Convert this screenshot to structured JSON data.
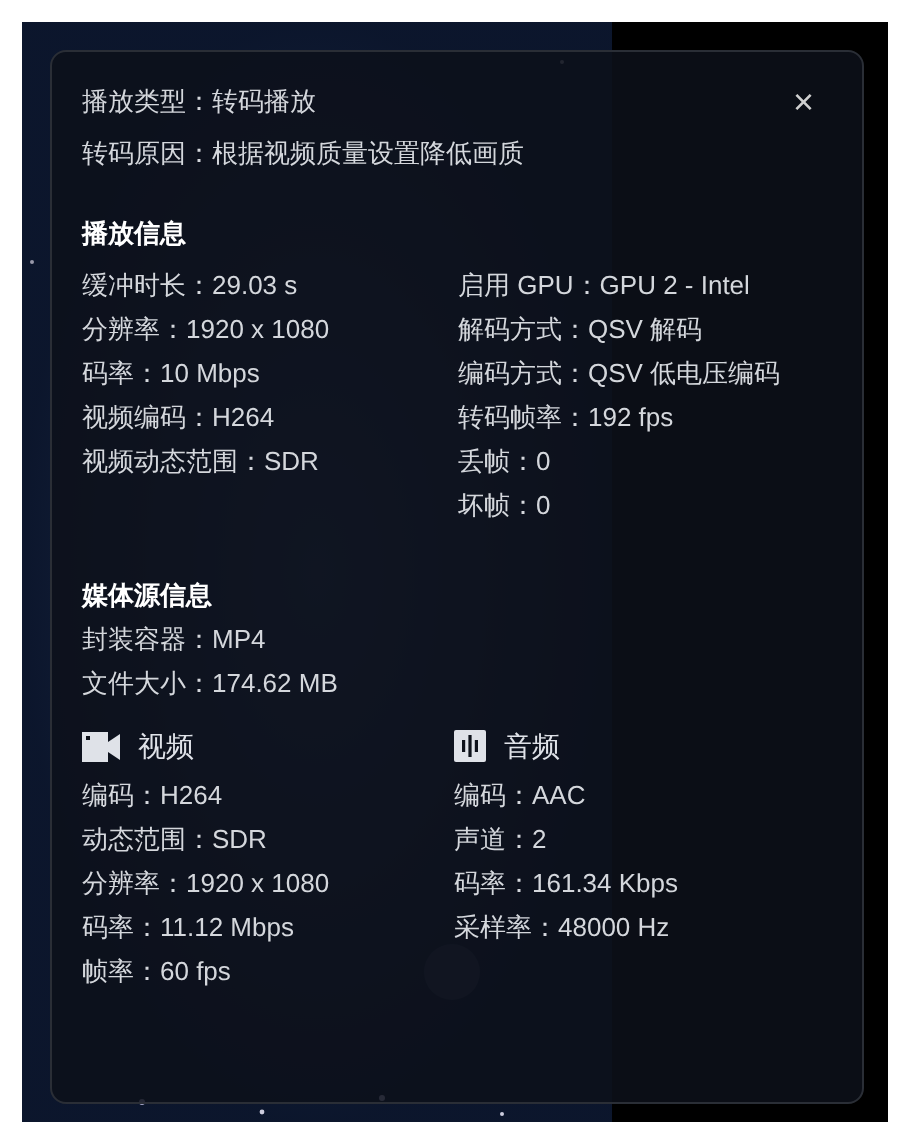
{
  "summary": [
    "播放类型：转码播放",
    "转码原因：根据视频质量设置降低画质"
  ],
  "playback": {
    "heading": "播放信息",
    "left": [
      "缓冲时长：29.03 s",
      "分辨率：1920 x 1080",
      "码率：10 Mbps",
      "视频编码：H264",
      "视频动态范围：SDR"
    ],
    "right": [
      "启用 GPU：GPU 2 - Intel",
      "解码方式：QSV 解码",
      "编码方式：QSV 低电压编码",
      "转码帧率：192 fps",
      "丢帧：0",
      "坏帧：0"
    ]
  },
  "media": {
    "heading": "媒体源信息",
    "rows": [
      "封装容器：MP4",
      "文件大小：174.62 MB"
    ],
    "streams": [
      {
        "kind": "video",
        "title": "视频",
        "rows": [
          "编码：H264",
          "动态范围：SDR",
          "分辨率：1920 x 1080",
          "码率：11.12 Mbps",
          "帧率：60 fps"
        ]
      },
      {
        "kind": "audio",
        "title": "音频",
        "rows": [
          "编码：AAC",
          "声道：2",
          "码率：161.34 Kbps",
          "采样率：48000 Hz"
        ]
      }
    ]
  },
  "close": "×"
}
